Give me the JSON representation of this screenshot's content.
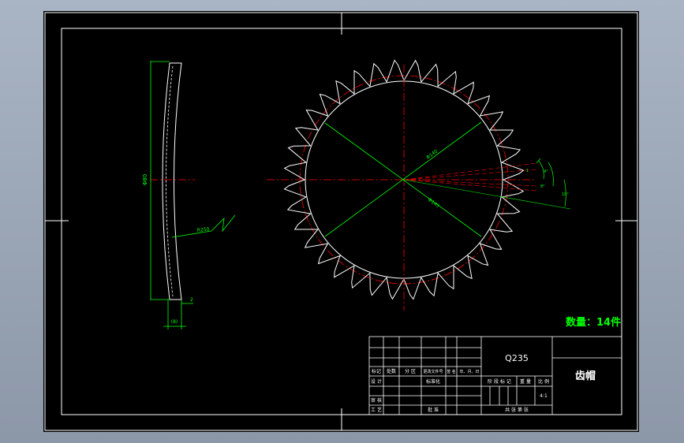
{
  "drawing": {
    "quantity_label": "数量：14件",
    "part_name": "齿帽",
    "material": "Q235",
    "scale": "4:1",
    "profile_dims": {
      "height": "Φ80",
      "width": "(8)",
      "thickness": "2",
      "radius": "R250"
    },
    "gear_dims": {
      "outer_diameter": "Φ140",
      "inner_diameter": "Φ145",
      "angle_a": "4°",
      "angle_b": "8°",
      "angle_c": "10°",
      "small_len": "1"
    },
    "title_block": {
      "row_labels": [
        "标记",
        "处数",
        "分 区",
        "更改文件号",
        "签 名",
        "年、月、日"
      ],
      "design": "设 计",
      "standard": "标准化",
      "stage_labels": [
        "阶 段 标 记",
        "重 量",
        "比 例"
      ],
      "review": "审 核",
      "process": "工 艺",
      "approve": "批 准",
      "sheets": "共   张   第   张"
    }
  },
  "colors": {
    "background": "#000000",
    "frame": "#ffffff",
    "dimension": "#00ff00",
    "centerline": "#ff0000",
    "quantity": "#00ff00"
  }
}
